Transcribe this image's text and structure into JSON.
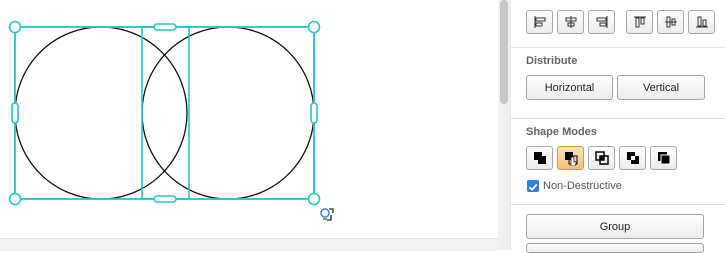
{
  "canvas": {
    "selection_color": "#26c5c9",
    "shapes": [
      "circle",
      "circle"
    ],
    "cursor_icon": "rotate-cursor-icon"
  },
  "panel": {
    "align_icons": [
      "align-left-icon",
      "align-center-icon",
      "align-right-icon",
      "align-top-icon",
      "align-middle-icon",
      "align-bottom-icon"
    ],
    "distribute": {
      "title": "Distribute",
      "horizontal_label": "Horizontal",
      "vertical_label": "Vertical"
    },
    "shape_modes": {
      "title": "Shape Modes",
      "icons": [
        "union-icon",
        "subtract-icon",
        "intersect-icon",
        "exclude-icon",
        "divide-icon"
      ],
      "selected_index": 1,
      "non_destructive_label": "Non-Destructive",
      "non_destructive_checked": true
    },
    "group_label": "Group"
  }
}
